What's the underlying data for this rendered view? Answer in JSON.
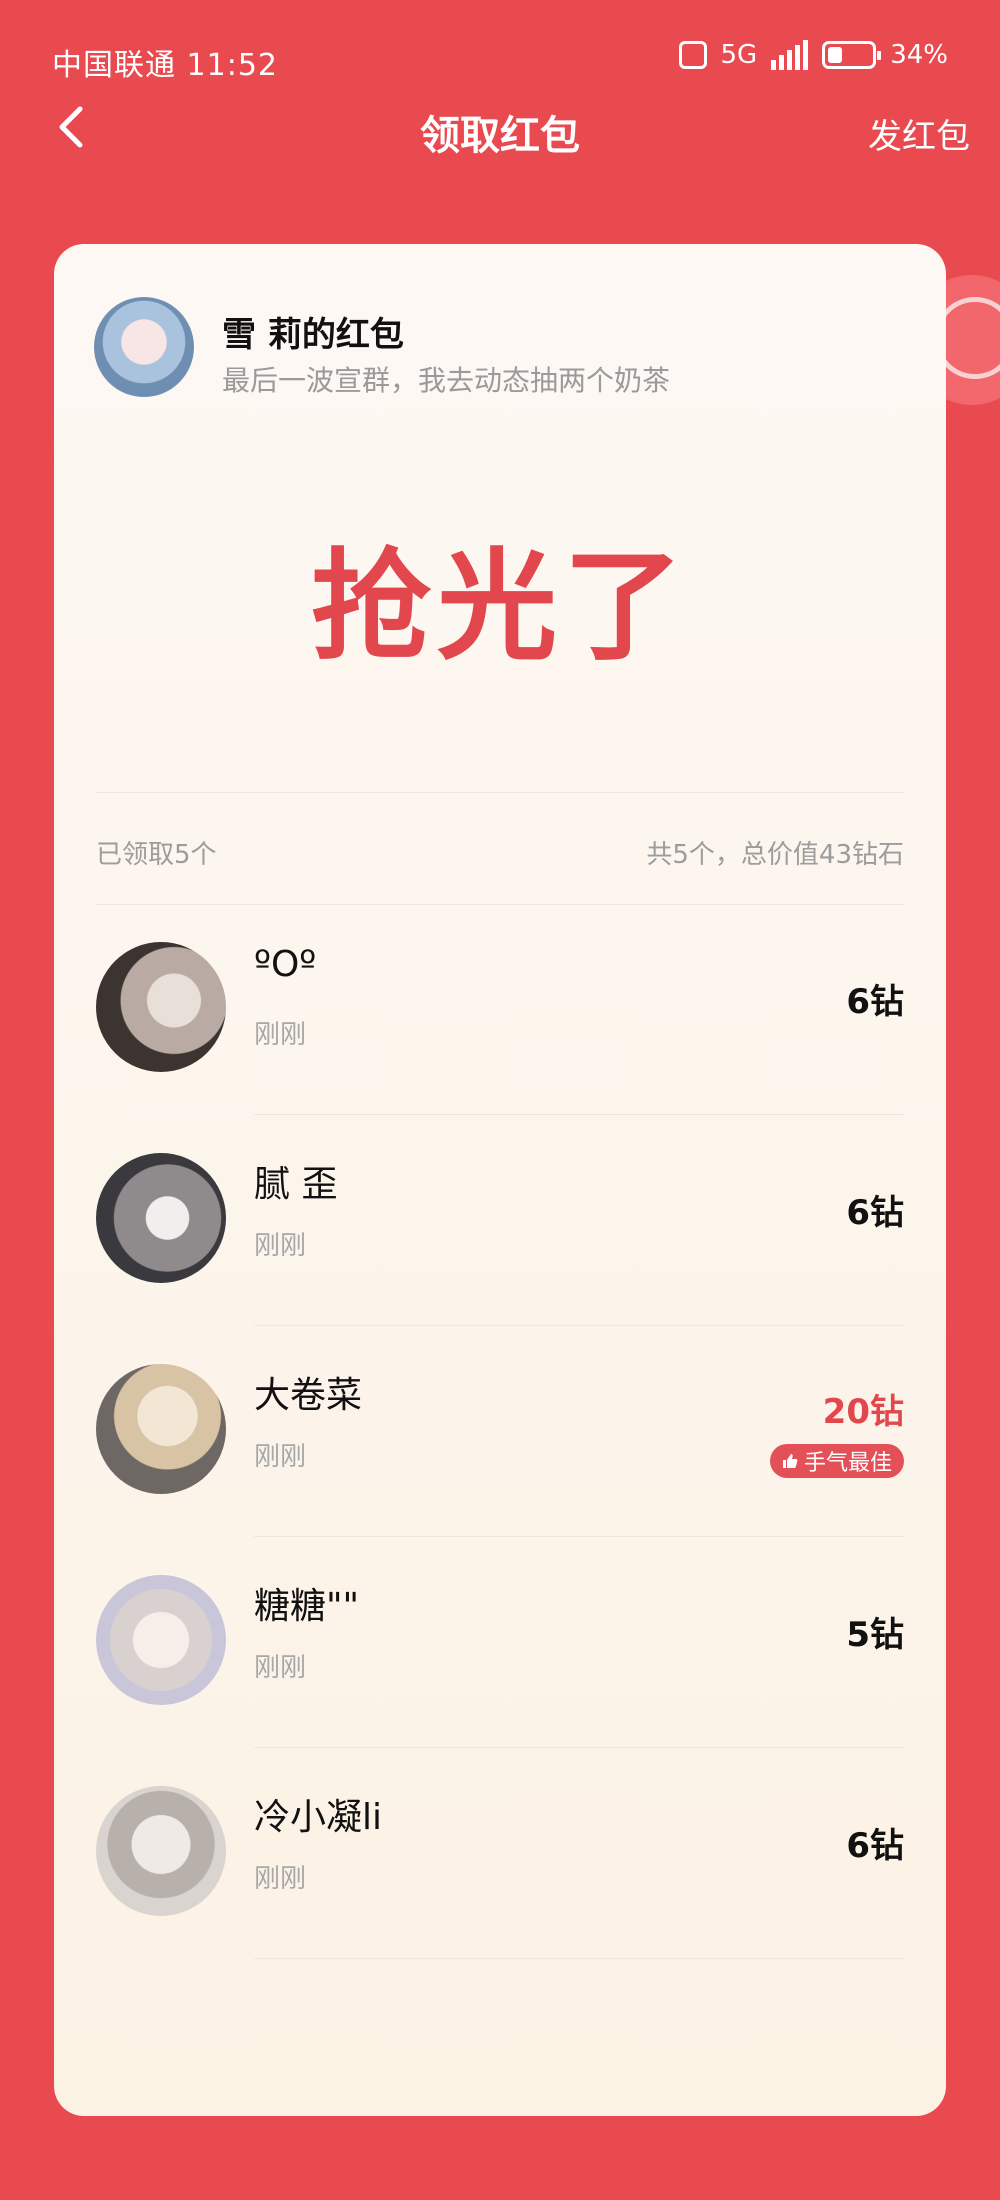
{
  "status_bar": {
    "carrier": "中国联通 11:52",
    "network": "5G",
    "battery": "34%",
    "battery_level": 0.34
  },
  "header": {
    "title": "领取红包",
    "send_label": "发红包"
  },
  "sender": {
    "name": "雪 莉的红包",
    "message": "最后一波宣群，我去动态抽两个奶茶"
  },
  "status_text": "抢光了",
  "summary": {
    "claimed": "已领取5个",
    "total": "共5个，总价值43钻石"
  },
  "claims": [
    {
      "name": "ºOº",
      "time": "刚刚",
      "amount": "6钻"
    },
    {
      "name": "腻 歪",
      "time": "刚刚",
      "amount": "6钻"
    },
    {
      "name": "大卷菜",
      "time": "刚刚",
      "amount": "20钻",
      "badge": "手气最佳"
    },
    {
      "name": "糖糖\"\"",
      "time": "刚刚",
      "amount": "5钻"
    },
    {
      "name": "冷小凝li",
      "time": "刚刚",
      "amount": "6钻"
    }
  ],
  "colors": {
    "background": "#e94a50",
    "accent": "#e2474d",
    "card": "#fcf4ec"
  }
}
